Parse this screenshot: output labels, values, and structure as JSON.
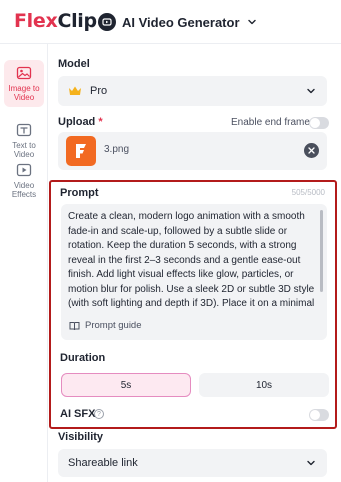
{
  "header": {
    "logo_part1": "Flex",
    "logo_part2": "Clip",
    "tool_name": "AI Video Generator"
  },
  "sidebar": {
    "items": [
      {
        "label": "Image to Video",
        "icon": "image-video-icon",
        "active": true
      },
      {
        "label": "Text to Video",
        "icon": "text-video-icon",
        "active": false
      },
      {
        "label": "Video Effects",
        "icon": "video-effects-icon",
        "active": false
      }
    ]
  },
  "model": {
    "label": "Model",
    "selected": "Pro",
    "icon": "crown-icon"
  },
  "upload": {
    "label": "Upload",
    "required_mark": "*",
    "end_frame_label": "Enable end frame",
    "file_name": "3.png"
  },
  "prompt": {
    "label": "Prompt",
    "counter": "505/5000",
    "text": "Create a clean, modern logo animation with a smooth fade-in and scale-up, followed by a subtle slide or rotation. Keep the duration 5 seconds, with a strong reveal in the first 2–3 seconds and a gentle ease-out finish. Add light visual effects like glow, particles, or motion blur for polish. Use a sleek 2D or subtle 3D style (with soft lighting and depth if 3D). Place it on a minimal background (gradient or soft",
    "guide_label": "Prompt guide"
  },
  "duration": {
    "label": "Duration",
    "options": [
      "5s",
      "10s"
    ],
    "selected": "5s"
  },
  "ai_sfx": {
    "label": "AI SFX",
    "help": "?"
  },
  "visibility": {
    "label": "Visibility",
    "selected": "Shareable link"
  },
  "colors": {
    "brand_red": "#e2334f",
    "thumb_orange": "#f26a22",
    "highlight_outline": "#b31b1b"
  }
}
